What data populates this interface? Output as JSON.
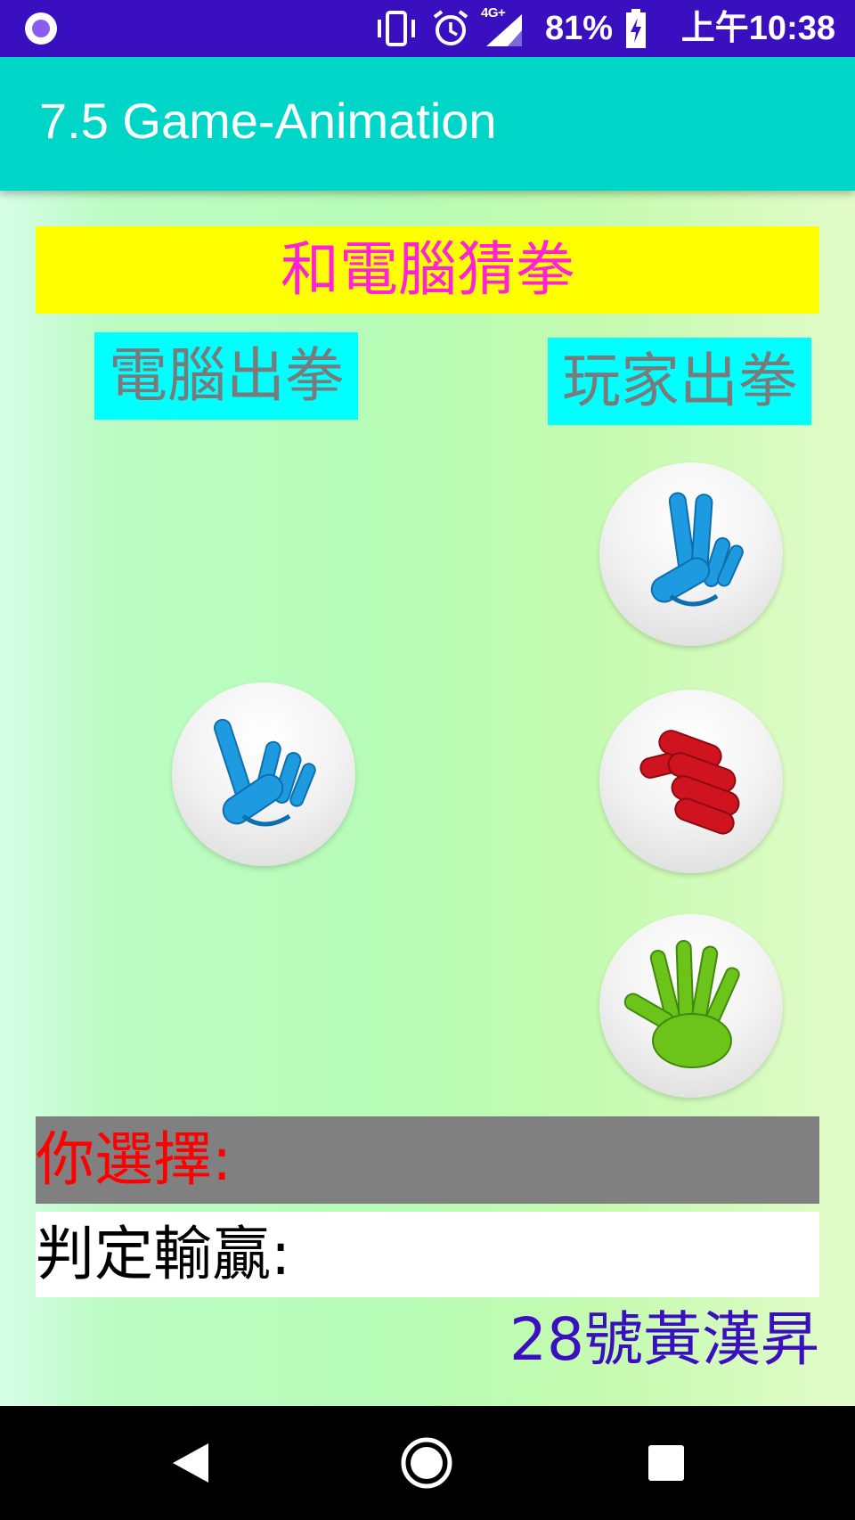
{
  "status_bar": {
    "network": "4G+",
    "battery": "81%",
    "time": "上午10:38",
    "icons": [
      "notification-dot-icon",
      "vibrate-icon",
      "alarm-icon",
      "signal-icon",
      "battery-charging-icon"
    ]
  },
  "app_bar": {
    "title": "7.5 Game-Animation"
  },
  "game": {
    "title": "和電腦猜拳",
    "computer_label": "電腦出拳",
    "player_label": "玩家出拳",
    "computer_hand": "scissors",
    "player_options": [
      "scissors",
      "rock",
      "paper"
    ],
    "choice_label": "你選擇:",
    "result_label": "判定輸贏:",
    "author": "28號黃漢昇"
  },
  "colors": {
    "status_bar": "#3a0fbf",
    "app_bar": "#00d6c8",
    "title_bg": "#ffff00",
    "title_text": "#ff22d8",
    "label_bg": "#00ffff",
    "label_text": "#7a7a7a",
    "scissors": "#1e9be0",
    "rock": "#d0141f",
    "paper": "#6cc41a",
    "choice_bg": "#808080",
    "choice_text": "#ff0000",
    "author_text": "#3a0fbf"
  },
  "navigation": {
    "icons": [
      "back-icon",
      "home-icon",
      "recents-icon"
    ]
  }
}
